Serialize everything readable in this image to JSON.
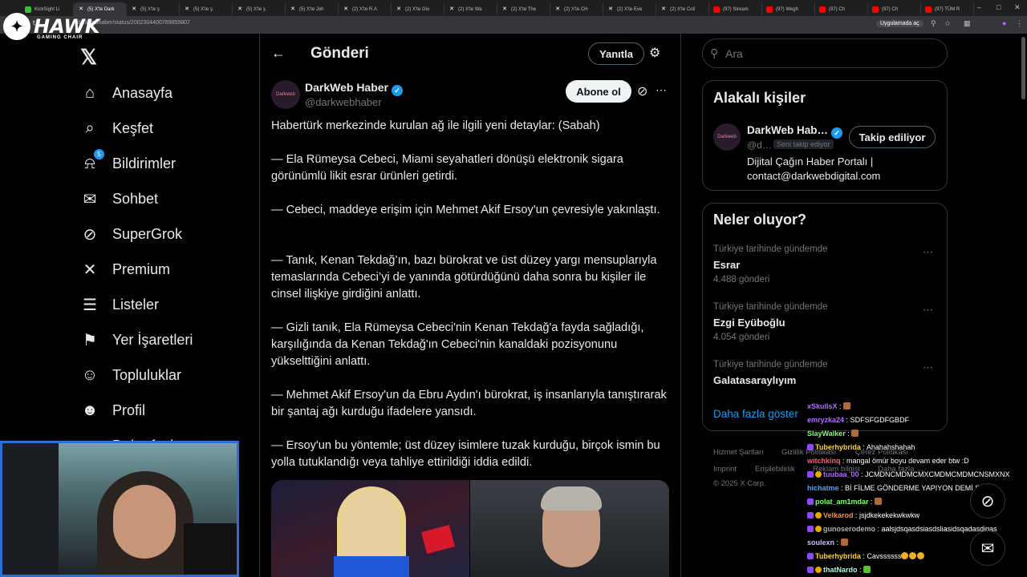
{
  "browser": {
    "tabs": [
      {
        "label": "KickSight Li",
        "icon": "ks",
        "active": false
      },
      {
        "label": "(5) X'te Dark",
        "icon": "x",
        "active": true
      },
      {
        "label": "(5) X'te ş",
        "icon": "x",
        "active": false
      },
      {
        "label": "(5) X'te ş",
        "icon": "x",
        "active": false
      },
      {
        "label": "(5) X'te ş",
        "icon": "x",
        "active": false
      },
      {
        "label": "(5) X'te Joh",
        "icon": "x",
        "active": false
      },
      {
        "label": "(2) X'te R.A",
        "icon": "x",
        "active": false
      },
      {
        "label": "(2) X'te Glo",
        "icon": "x",
        "active": false
      },
      {
        "label": "(2) X'te Wa",
        "icon": "x",
        "active": false
      },
      {
        "label": "(2) X'te The",
        "icon": "x",
        "active": false
      },
      {
        "label": "(2) X'te CH",
        "icon": "x",
        "active": false
      },
      {
        "label": "(2) X'te Eve",
        "icon": "x",
        "active": false
      },
      {
        "label": "(2) X'te Coll",
        "icon": "x",
        "active": false
      },
      {
        "label": "(97) Stream",
        "icon": "yt",
        "active": false
      },
      {
        "label": "(97) Wegh",
        "icon": "yt",
        "active": false
      },
      {
        "label": "(97) Ch",
        "icon": "yt",
        "active": false
      },
      {
        "label": "(97) Ch",
        "icon": "yt",
        "active": false
      },
      {
        "label": "(97) TÜM R",
        "icon": "yt",
        "active": false
      }
    ],
    "url": "darkwebhaber/status/2002304400769855807",
    "open_app": "Uygulamada aç"
  },
  "overlay_logo": {
    "brand": "HAWK",
    "sub": "GAMING CHAIR"
  },
  "nav": {
    "items": [
      {
        "label": "Anasayfa",
        "icon": "home-icon"
      },
      {
        "label": "Keşfet",
        "icon": "search-icon"
      },
      {
        "label": "Bildirimler",
        "icon": "bell-icon",
        "badge": "5"
      },
      {
        "label": "Sohbet",
        "icon": "mail-icon"
      },
      {
        "label": "SuperGrok",
        "icon": "grok-icon"
      },
      {
        "label": "Premium",
        "icon": "x-icon"
      },
      {
        "label": "Listeler",
        "icon": "list-icon"
      },
      {
        "label": "Yer İşaretleri",
        "icon": "bookmark-icon"
      },
      {
        "label": "Topluluklar",
        "icon": "communities-icon"
      },
      {
        "label": "Profil",
        "icon": "profile-icon"
      },
      {
        "label": "Daha fazla",
        "icon": "more-icon"
      }
    ]
  },
  "post_header": {
    "title": "Gönderi",
    "reply_label": "Yanıtla"
  },
  "post": {
    "author": "DarkWeb Haber",
    "handle": "@darkwebhaber",
    "avatar_text": "Darkweb",
    "subscribe_label": "Abone ol",
    "paragraphs": [
      "Habertürk merkezinde kurulan ağ ile ilgili yeni detaylar: (Sabah)",
      "— Ela Rümeysa Cebeci, Miami seyahatleri dönüşü elektronik sigara görünümlü likit esrar ürünleri getirdi.",
      "— Cebeci, maddeye erişim için Mehmet Akif Ersoy'un çevresiyle yakınlaştı.",
      "— Tanık, Kenan Tekdağ’ın, bazı bürokrat ve üst düzey yargı mensuplarıyla temaslarında Cebeci’yi de yanında götürdüğünü daha sonra bu kişiler ile cinsel ilişkiye girdiğini anlattı.",
      "— Gizli tanık, Ela Rümeysa Cebeci'nin Kenan Tekdağ'a fayda sağladığı, karşılığında da Kenan Tekdağ'ın Cebeci'nin kanaldaki pozisyonunu yükselttiğini anlattı.",
      "— Mehmet Akif Ersoy'un da Ebru Aydın'ı bürokrat, iş insanlarıyla tanıştırarak bir şantaj ağı kurduğu ifadelere yansıdı.",
      "— Ersoy'un bu yöntemle; üst düzey isimlere tuzak kurduğu, birçok ismin bu yolla tutuklandığı veya tahliye ettirildiği iddia edildi."
    ]
  },
  "search": {
    "placeholder": "Ara"
  },
  "related": {
    "title": "Alakalı kişiler",
    "name": "DarkWeb Hab…",
    "handle": "@d…",
    "follows_you": "Seni takip ediyor",
    "follow_label": "Takip ediliyor",
    "bio": "Dijital Çağın Haber Portalı | contact@darkwebdigital.com",
    "avatar_text": "Darkweb"
  },
  "trends": {
    "title": "Neler oluyor?",
    "items": [
      {
        "context": "Türkiye tarihinde gündemde",
        "name": "Esrar",
        "count": "4.488 gönderi"
      },
      {
        "context": "Türkiye tarihinde gündemde",
        "name": "Ezgi Eyüboğlu",
        "count": "4.054 gönderi"
      },
      {
        "context": "Türkiye tarihinde gündemde",
        "name": "Galatasaraylıyım",
        "count": ""
      }
    ],
    "show_more": "Daha fazla göster"
  },
  "footer": {
    "links": [
      "Hizmet Şartları",
      "Gizlilik Politikası",
      "Çerez Politikası",
      "Imprint",
      "Erişilebilirlik",
      "Reklam bilgisi",
      "Daha fazla …"
    ],
    "copyright": "© 2025 X Corp."
  },
  "chat": [
    {
      "user": "xSkullsX",
      "text": "",
      "color": "#b06aff",
      "badge": "none",
      "emoji": "brown"
    },
    {
      "user": "emryzka24",
      "text": "SDFSFGDFGBDF",
      "color": "#b06aff",
      "badge": "none",
      "emoji": ""
    },
    {
      "user": "SlayWalker",
      "text": "",
      "color": "#7cff6b",
      "badge": "none",
      "emoji": "brown"
    },
    {
      "user": "Tuberhybrida",
      "text": "Ahahahshahah",
      "color": "#ffd23c",
      "badge": "sub",
      "emoji": ""
    },
    {
      "user": "witchkinq",
      "text": "mangal ömür boyu devam eder btw :D",
      "color": "#ff5a7a",
      "badge": "none",
      "emoji": ""
    },
    {
      "user": "tuubaa_00",
      "text": "JCMDNCMDMCMXCMDMCMDMCNSMXNX",
      "color": "#b06aff",
      "badge": "multi",
      "emoji": ""
    },
    {
      "user": "hichatme",
      "text": "Bİ FİLME GÖNDERME YAPIYON DEMİ ŞUAN",
      "color": "#4aa8ff",
      "badge": "none",
      "emoji": ""
    },
    {
      "user": "polat_am1mdar",
      "text": "",
      "color": "#7cff6b",
      "badge": "sub",
      "emoji": "brown"
    },
    {
      "user": "Velkarod",
      "text": "jsjdkekekekwkwkw",
      "color": "#ff8a3c",
      "badge": "multi",
      "emoji": ""
    },
    {
      "user": "gunoserodemo",
      "text": "aalsjdsqasdsiasdsliasidsqadasdiqas",
      "color": "#b0b0b0",
      "badge": "multi",
      "emoji": ""
    },
    {
      "user": "soulexn",
      "text": "",
      "color": "#c0c0ff",
      "badge": "none",
      "emoji": "brown"
    },
    {
      "user": "Tuberhybrida",
      "text": "Cavssssss",
      "color": "#ffd23c",
      "badge": "sub",
      "emoji": "yellow3"
    },
    {
      "user": "thatNardo",
      "text": "",
      "color": "#a0ffe0",
      "badge": "multi",
      "emoji": "green"
    }
  ]
}
